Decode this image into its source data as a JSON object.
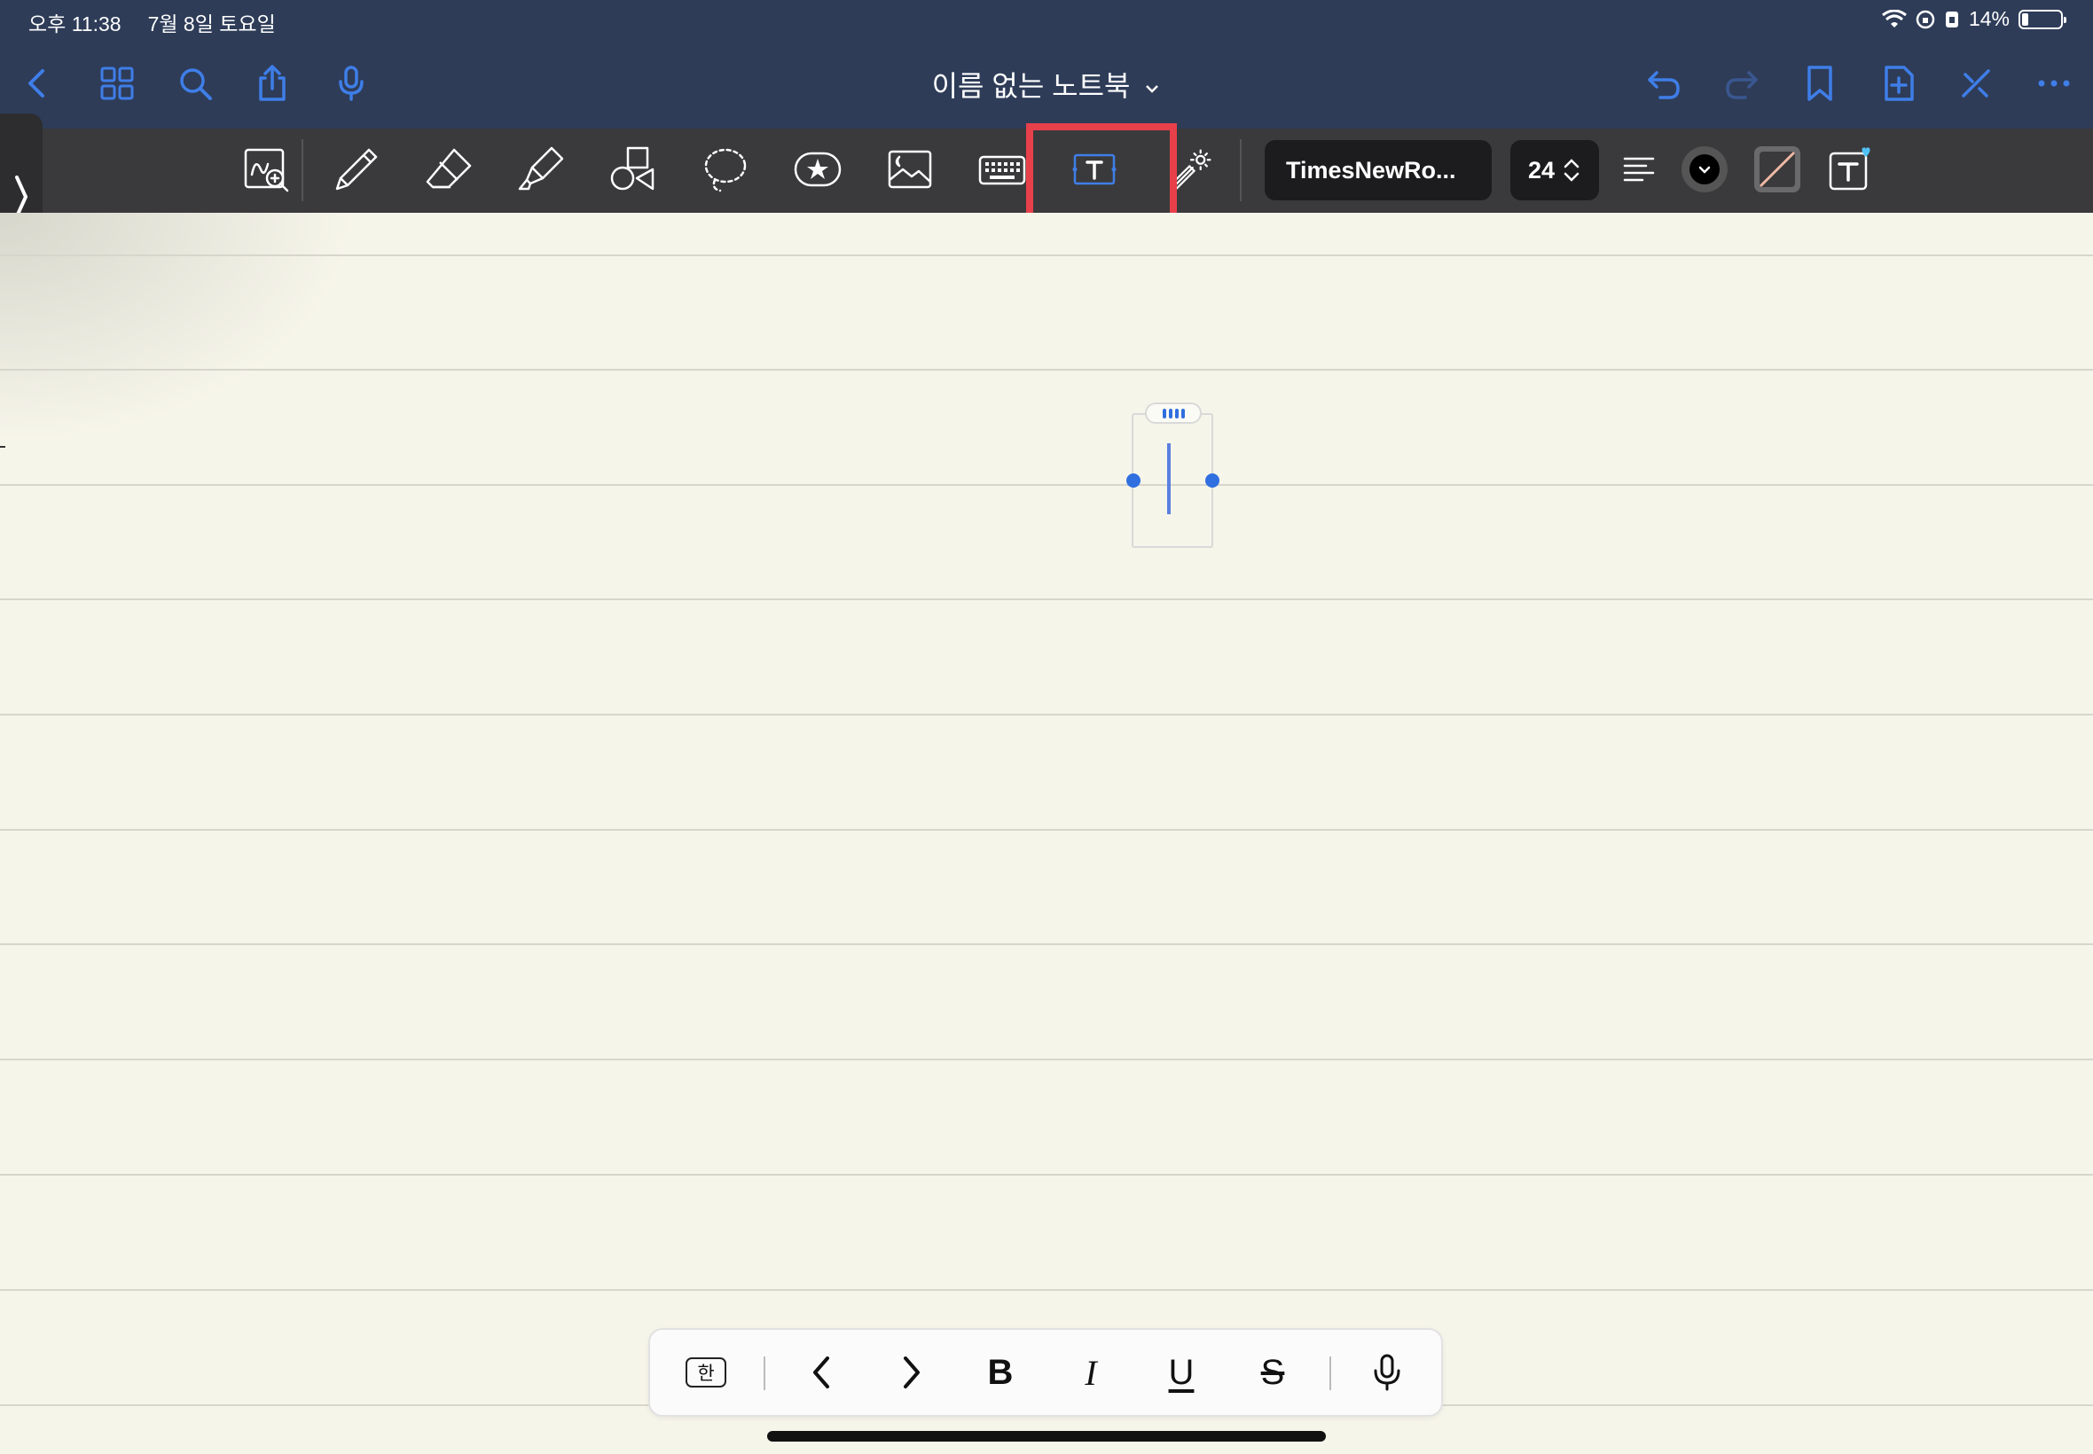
{
  "status_bar": {
    "time": "오후 11:38",
    "date": "7월 8일 토요일",
    "battery": "14%",
    "icons": [
      "wifi-icon",
      "orientation-lock-icon",
      "do-not-disturb-icon",
      "battery-icon"
    ]
  },
  "nav": {
    "title": "이름 없는 노트북",
    "left_icons": [
      "back-chevron-icon",
      "grid-icon",
      "search-icon",
      "share-icon",
      "microphone-icon"
    ],
    "right_icons": [
      "undo-icon",
      "redo-icon",
      "bookmark-icon",
      "add-page-icon",
      "close-toolbar-icon",
      "more-icon"
    ]
  },
  "toolbar": {
    "tools": [
      "zoom-window-icon",
      "pen-icon",
      "eraser-icon",
      "highlighter-icon",
      "shapes-icon",
      "lasso-icon",
      "sticker-icon",
      "image-icon",
      "keyboard-icon",
      "text-box-icon",
      "laser-pointer-icon"
    ],
    "selected_tool": "text-box-icon",
    "font_name": "TimesNewRo...",
    "font_size": "24",
    "text_color": "#000000"
  },
  "keyboard_bar": {
    "ime_label": "한",
    "bold_label": "B",
    "italic_label": "I",
    "underline_label": "U",
    "strike_label": "S"
  },
  "colors": {
    "nav_bg": "#2e3c58",
    "toolbar_bg": "#3a3a3c",
    "accent": "#3f7ee8",
    "paper": "#f6f5ea",
    "highlight": "#e8404a"
  }
}
